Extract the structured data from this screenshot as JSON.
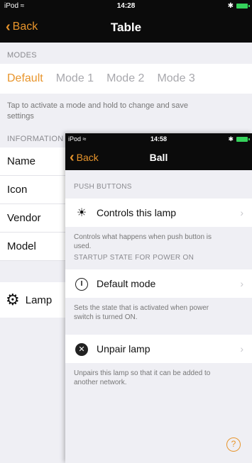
{
  "back_screen": {
    "status": {
      "carrier": "iPod ≈",
      "time": "14:28",
      "bt": "✱"
    },
    "nav": {
      "back": "Back",
      "title": "Table"
    },
    "modes_header": "MODES",
    "modes": [
      "Default",
      "Mode 1",
      "Mode 2",
      "Mode 3"
    ],
    "active_mode": "Default",
    "hint": "Tap to activate a mode and hold to change and save settings",
    "info_header": "INFORMATION",
    "info_rows": [
      "Name",
      "Icon",
      "Vendor",
      "Model"
    ],
    "lamp_label": "Lamp"
  },
  "front_screen": {
    "status": {
      "carrier": "iPod ≈",
      "time": "14:58",
      "bt": "✱"
    },
    "nav": {
      "back": "Back",
      "title": "Ball"
    },
    "push_header": "PUSH BUTTONS",
    "controls_label": "Controls this lamp",
    "controls_desc": "Controls what happens when push button is used.",
    "startup_header": "STARTUP STATE FOR POWER ON",
    "default_mode_label": "Default mode",
    "default_mode_desc": "Sets the state that is activated when power switch is turned ON.",
    "unpair_label": "Unpair lamp",
    "unpair_desc": "Unpairs this lamp so that it can be added to another network."
  },
  "colors": {
    "accent": "#e8952c",
    "battery": "#35d35b"
  }
}
